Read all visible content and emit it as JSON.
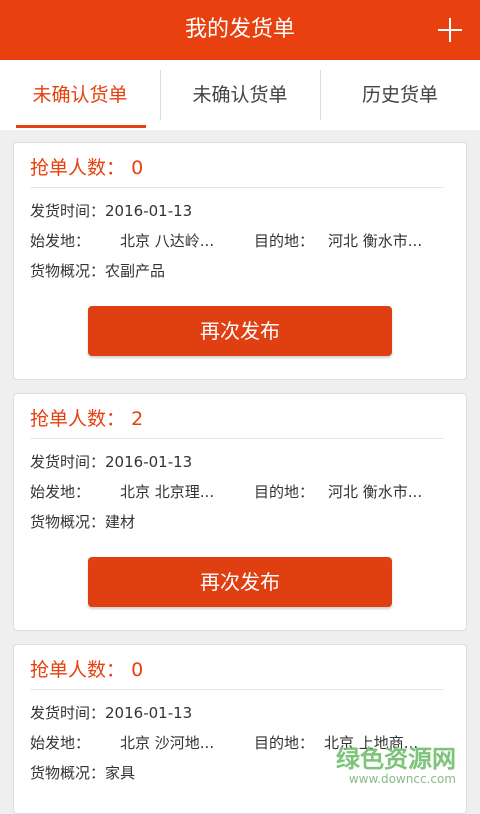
{
  "appbar": {
    "title": "我的发货单",
    "add_icon": "plus-icon",
    "color": "#e8400e"
  },
  "tabs": [
    {
      "label": "未确认货单",
      "active": true
    },
    {
      "label": "未确认货单",
      "active": false
    },
    {
      "label": "历史货单",
      "active": false
    }
  ],
  "labels": {
    "grab_count": "抢单人数：",
    "ship_time": "发货时间：",
    "origin": "始发地：",
    "destination": "目的地：",
    "cargo": "货物概况：",
    "republish": "再次发布"
  },
  "orders": [
    {
      "grab_count": "0",
      "ship_time": "2016-01-13",
      "origin": "北京 八达岭...",
      "destination": "河北 衡水市...",
      "cargo": "农副产品"
    },
    {
      "grab_count": "2",
      "ship_time": "2016-01-13",
      "origin": "北京 北京理...",
      "destination": "河北 衡水市...",
      "cargo": "建材"
    },
    {
      "grab_count": "0",
      "ship_time": "2016-01-13",
      "origin": "北京 沙河地...",
      "destination": "北京 上地商...",
      "cargo": "家具"
    }
  ],
  "watermark": {
    "name": "绿色资源网",
    "url": "www.downcc.com"
  }
}
